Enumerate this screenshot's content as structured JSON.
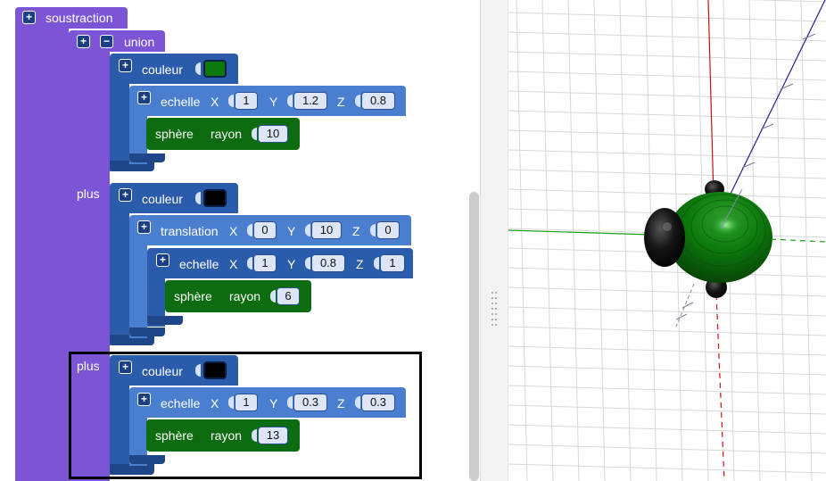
{
  "blocks": {
    "soustraction": {
      "label": "soustraction"
    },
    "union": {
      "label": "union"
    },
    "plus_label": "plus",
    "group1": {
      "couleur_label": "couleur",
      "color": "#0b7a0b",
      "echelle": {
        "label": "echelle",
        "x_label": "X",
        "y_label": "Y",
        "z_label": "Z",
        "x": "1",
        "y": "1.2",
        "z": "0.8"
      },
      "sphere": {
        "label": "sphère",
        "rayon_label": "rayon",
        "rayon": "10"
      }
    },
    "group2": {
      "couleur_label": "couleur",
      "color": "#000000",
      "translation": {
        "label": "translation",
        "x_label": "X",
        "y_label": "Y",
        "z_label": "Z",
        "x": "0",
        "y": "10",
        "z": "0"
      },
      "echelle": {
        "label": "echelle",
        "x_label": "X",
        "y_label": "Y",
        "z_label": "Z",
        "x": "1",
        "y": "0.8",
        "z": "1"
      },
      "sphere": {
        "label": "sphère",
        "rayon_label": "rayon",
        "rayon": "6"
      }
    },
    "group3": {
      "couleur_label": "couleur",
      "color": "#000000",
      "echelle": {
        "label": "echelle",
        "x_label": "X",
        "y_label": "Y",
        "z_label": "Z",
        "x": "1",
        "y": "0.3",
        "z": "0.3"
      },
      "sphere": {
        "label": "sphère",
        "rayon_label": "rayon",
        "rayon": "13"
      }
    }
  },
  "icons": {
    "expand": "plus-icon",
    "collapse": "minus-icon"
  },
  "glyphs": {
    "plus": "+",
    "minus": "−"
  },
  "viewport": {
    "axis_x_color": "#16a016",
    "axis_y_color": "#cc1111",
    "axis_z_color": "#222288",
    "object_color": "#0b6e0b"
  }
}
